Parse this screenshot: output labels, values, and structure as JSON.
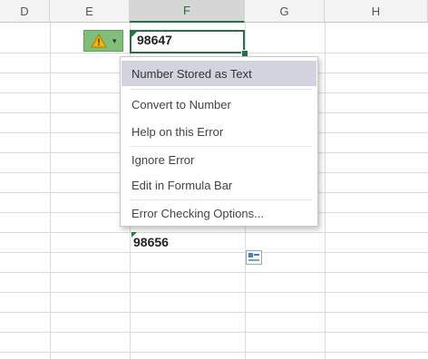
{
  "columns": [
    "D",
    "E",
    "F",
    "G",
    "H"
  ],
  "selected_column": "F",
  "cells": {
    "active_value": "98647",
    "lower_value": "98656"
  },
  "error_menu": {
    "items": [
      {
        "label": "Number Stored as Text"
      },
      {
        "label": "Convert to Number"
      },
      {
        "label": "Help on this Error"
      },
      {
        "label": "Ignore Error"
      },
      {
        "label": "Edit in Formula Bar"
      },
      {
        "label": "Error Checking Options..."
      }
    ]
  },
  "colors": {
    "accent": "#217346",
    "warning": "#f5b400",
    "error_button": "#7fbf7a",
    "menu_highlight": "#d3d3df"
  },
  "icons": {
    "error_button": "warning-icon",
    "dropdown": "chevron-down-icon",
    "paste_options": "paste-options-icon"
  }
}
